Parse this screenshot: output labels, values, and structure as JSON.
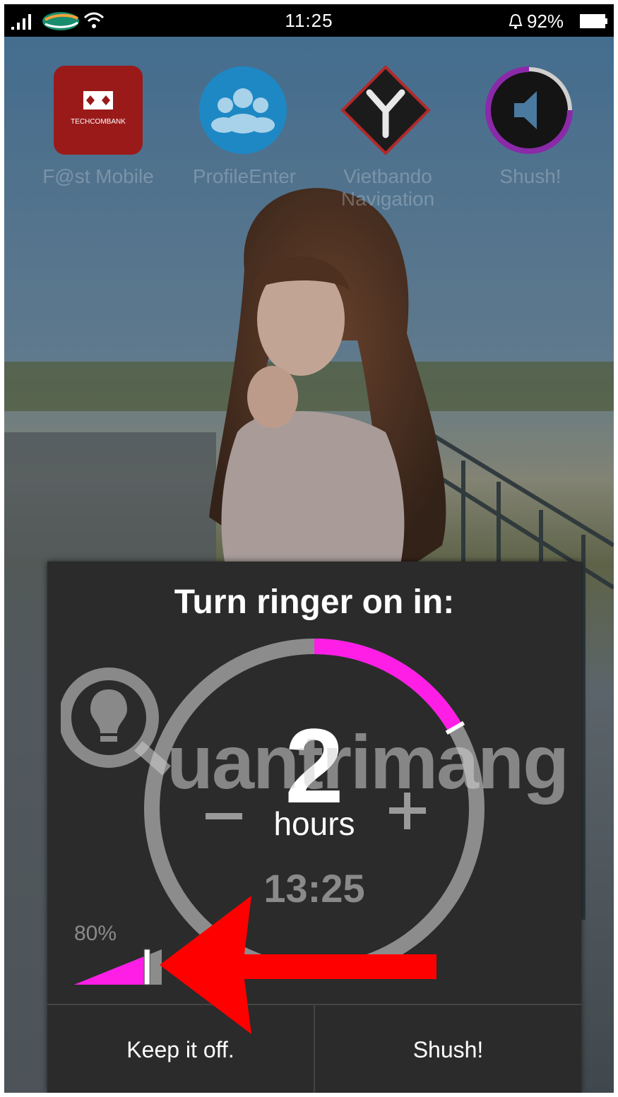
{
  "status_bar": {
    "time": "11:25",
    "battery_percent": "92%",
    "icons": [
      "signal-icon",
      "carrier-logo-icon",
      "wifi-icon",
      "alarm-icon",
      "battery-icon"
    ]
  },
  "home_screen": {
    "apps": [
      {
        "icon": "techcombank-icon",
        "label": "F@st Mobile",
        "logo_text": "TECHCOMBANK"
      },
      {
        "icon": "profile-people-icon",
        "label": "ProfileEnter"
      },
      {
        "icon": "navigation-diamond-icon",
        "label": "Vietbando Navigation"
      },
      {
        "icon": "shush-speaker-icon",
        "label": "Shush!"
      }
    ]
  },
  "dialog": {
    "title": "Turn ringer on in:",
    "hours_value": "2",
    "hours_unit": "hours",
    "end_time": "13:25",
    "dial_fraction": 0.167,
    "volume_label": "80%",
    "volume_fraction": 0.8,
    "keep_off_label": "Keep it off.",
    "shush_label": "Shush!",
    "accent_color": "#ff1ee6",
    "track_color": "#8c8c8c"
  },
  "watermark": {
    "text": "uantrimang"
  },
  "annotation": {
    "arrow_color": "#ff0000"
  }
}
